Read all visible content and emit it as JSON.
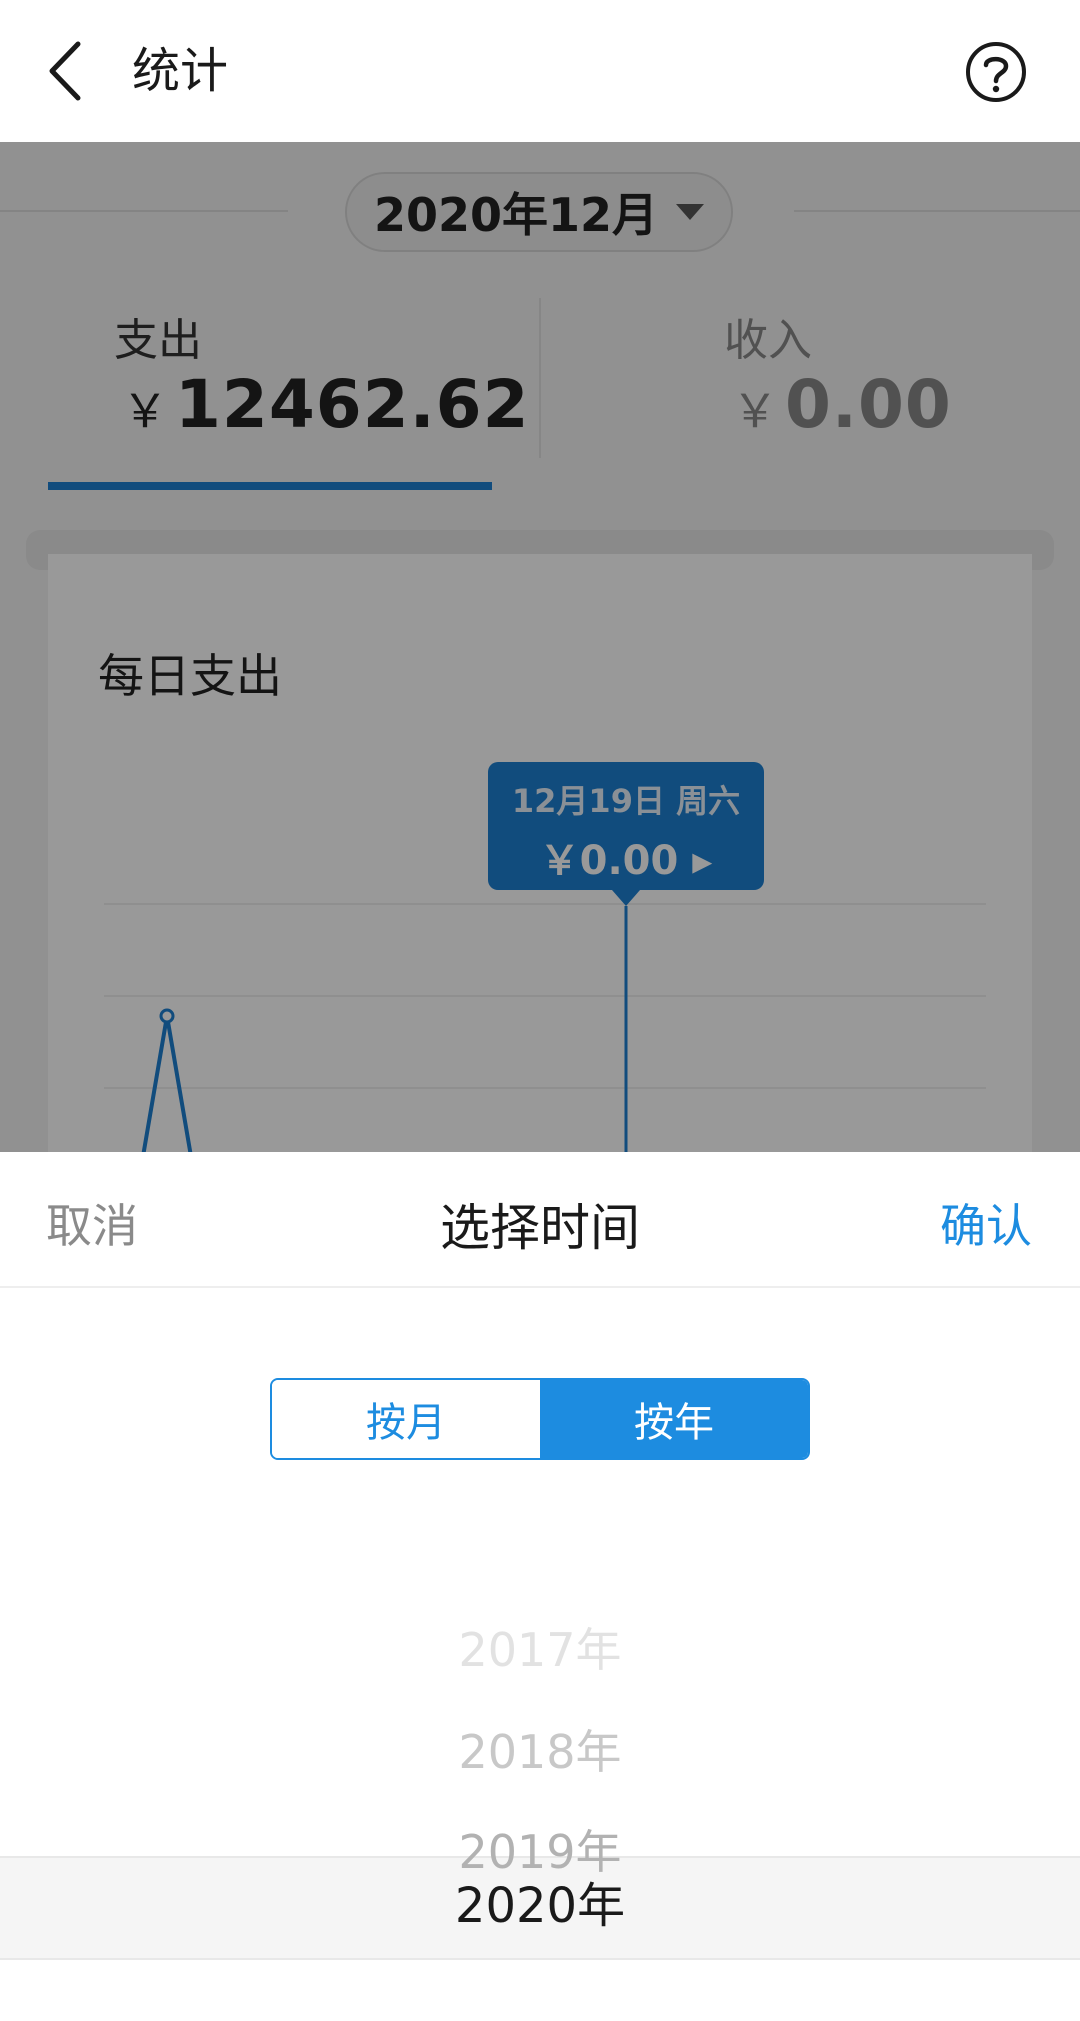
{
  "header": {
    "title": "统计"
  },
  "period": {
    "selected": "2020年12月"
  },
  "tabs": [
    {
      "label": "支出",
      "currency": "￥",
      "amount": "12462.62",
      "active": true
    },
    {
      "label": "收入",
      "currency": "￥",
      "amount": "0.00",
      "active": false
    }
  ],
  "card": {
    "title": "每日支出",
    "tooltip": {
      "date": "12月19日 周六",
      "value": "￥0.00 ▸"
    }
  },
  "sheet": {
    "cancel_label": "取消",
    "title": "选择时间",
    "confirm_label": "确认",
    "segments": [
      {
        "label": "按月",
        "selected": false
      },
      {
        "label": "按年",
        "selected": true
      }
    ],
    "years": [
      "2017年",
      "2018年",
      "2019年",
      "2020年"
    ],
    "selected_year": "2020年"
  },
  "colors": {
    "accent": "#1d8ce0",
    "chart_line": "#1d7fd0"
  },
  "icons": {
    "back": "chevron-left-icon",
    "help": "question-circle-icon"
  }
}
